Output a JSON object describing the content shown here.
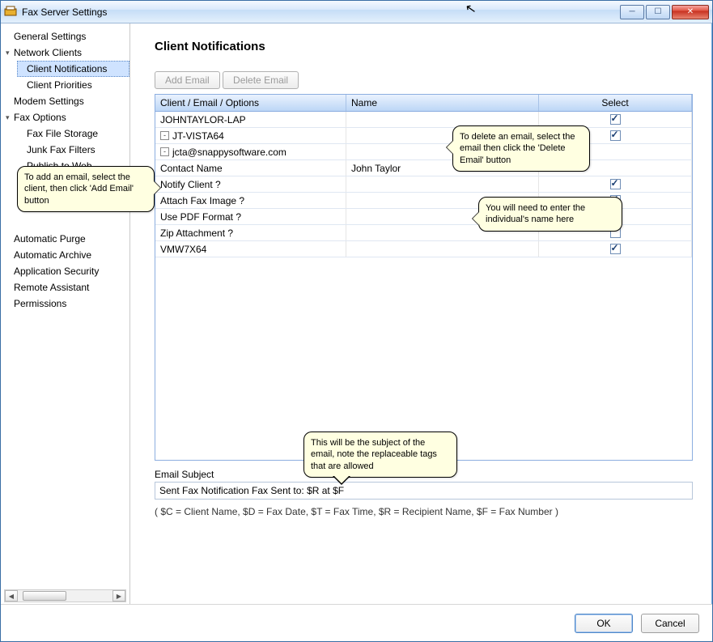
{
  "window": {
    "title": "Fax Server Settings"
  },
  "sidebar": {
    "items": [
      {
        "label": "General Settings"
      },
      {
        "label": "Network Clients",
        "open": true,
        "children": [
          {
            "label": "Client Notifications",
            "selected": true
          },
          {
            "label": "Client Priorities"
          }
        ]
      },
      {
        "label": "Modem Settings"
      },
      {
        "label": "Fax Options",
        "open": true,
        "children": [
          {
            "label": "Fax File Storage"
          },
          {
            "label": "Junk Fax Filters"
          },
          {
            "label": "Publish to Web"
          }
        ]
      },
      {
        "label": "Automatic Purge"
      },
      {
        "label": "Automatic Archive"
      },
      {
        "label": "Application Security"
      },
      {
        "label": "Remote Assistant"
      },
      {
        "label": "Permissions"
      }
    ]
  },
  "page": {
    "title": "Client Notifications",
    "buttons": {
      "add": "Add Email",
      "delete": "Delete Email"
    },
    "grid": {
      "headers": {
        "a": "Client / Email / Options",
        "b": "Name",
        "c": "Select"
      },
      "rows": [
        {
          "indent": 0,
          "a": "JOHNTAYLOR-LAP",
          "b": "",
          "checked": true
        },
        {
          "indent": 0,
          "a": "JT-VISTA64",
          "b": "",
          "checked": true,
          "exp": "-"
        },
        {
          "indent": 1,
          "a": "jcta@snappysoftware.com",
          "b": "",
          "checked": null,
          "exp": "-"
        },
        {
          "indent": 2,
          "a": "Contact Name",
          "b": "John Taylor",
          "checked": null
        },
        {
          "indent": 2,
          "a": "Notify Client ?",
          "b": "",
          "checked": true
        },
        {
          "indent": 2,
          "a": "Attach Fax Image ?",
          "b": "",
          "checked": true
        },
        {
          "indent": 2,
          "a": "Use PDF Format ?",
          "b": "",
          "checked": true
        },
        {
          "indent": 2,
          "a": "Zip Attachment ?",
          "b": "",
          "checked": false
        },
        {
          "indent": 0,
          "a": "VMW7X64",
          "b": "",
          "checked": true
        }
      ]
    },
    "email_subject_label": "Email Subject",
    "email_subject_value": "Sent Fax Notification Fax Sent to: $R at $F",
    "legend": "( $C = Client Name, $D = Fax Date, $T = Fax Time, $R = Recipient Name, $F = Fax Number )"
  },
  "callouts": {
    "c1": "To add an email, select the client, then click 'Add Email' button",
    "c2": "To delete an email, select the email then click the 'Delete Email' button",
    "c3": "You will need to enter the individual's name here",
    "c4": "This will be the subject of the email, note the replaceable tags that are allowed"
  },
  "dialog": {
    "ok": "OK",
    "cancel": "Cancel"
  }
}
